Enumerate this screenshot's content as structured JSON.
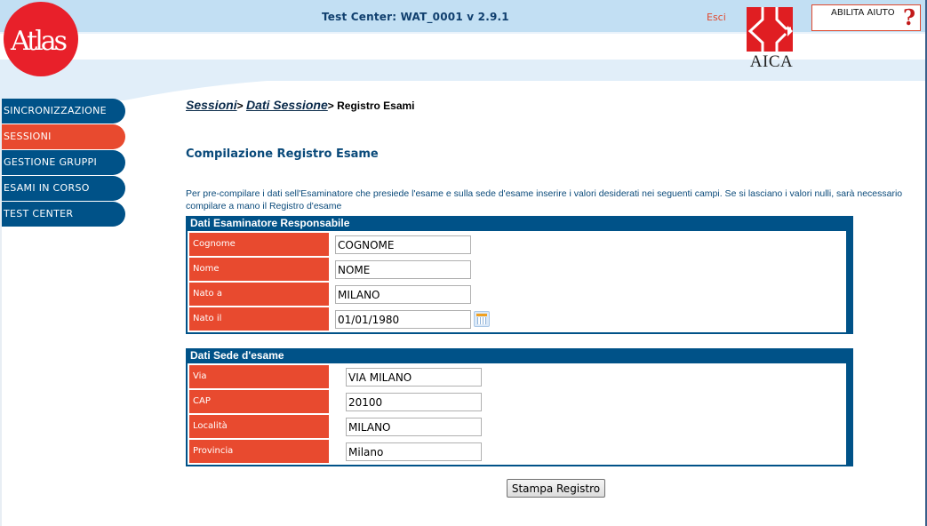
{
  "header": {
    "app_title": "Test Center: WAT_0001 v 2.9.1",
    "logout_label": "Esci",
    "help_label": "ABILITA AIUTO",
    "help_icon": "question-mark-icon",
    "left_logo_text": "Atlas",
    "right_logo_text": "AICA"
  },
  "sidebar": {
    "items": [
      {
        "label": "SINCRONIZZAZIONE",
        "active": false
      },
      {
        "label": "SESSIONI",
        "active": true
      },
      {
        "label": "GESTIONE GRUPPI",
        "active": false
      },
      {
        "label": "ESAMI IN CORSO",
        "active": false
      },
      {
        "label": "TEST CENTER",
        "active": false
      }
    ]
  },
  "breadcrumb": {
    "items": [
      "Sessioni",
      "Dati Sessione"
    ],
    "separator": ">",
    "current": "Registro Esami"
  },
  "main": {
    "title": "Compilazione Registro Esame",
    "intro": "Per pre-compilare i dati sell'Esaminatore che presiede l'esame e sulla sede d'esame inserire i valori desiderati nei seguenti campi. Se si lasciano i valori nulli, sarà necessario compilare a mano il Registro d'esame",
    "examiner_panel": {
      "title": "Dati Esaminatore Responsabile",
      "fields": [
        {
          "label": "Cognome",
          "value": "COGNOME"
        },
        {
          "label": "Nome",
          "value": "NOME"
        },
        {
          "label": "Nato a",
          "value": "MILANO"
        },
        {
          "label": "Nato il",
          "value": "01/01/1980"
        }
      ]
    },
    "site_panel": {
      "title": "Dati Sede d'esame",
      "fields": [
        {
          "label": "Via",
          "value": "VIA MILANO"
        },
        {
          "label": "CAP",
          "value": "20100"
        },
        {
          "label": "Località",
          "value": "MILANO"
        },
        {
          "label": "Provincia",
          "value": "Milano"
        }
      ]
    },
    "print_button_label": "Stampa Registro"
  },
  "colors": {
    "primary_blue": "#005288",
    "accent_orange": "#e84a2f",
    "header_band": "#c2dff3",
    "logo_red": "#e8202a"
  }
}
